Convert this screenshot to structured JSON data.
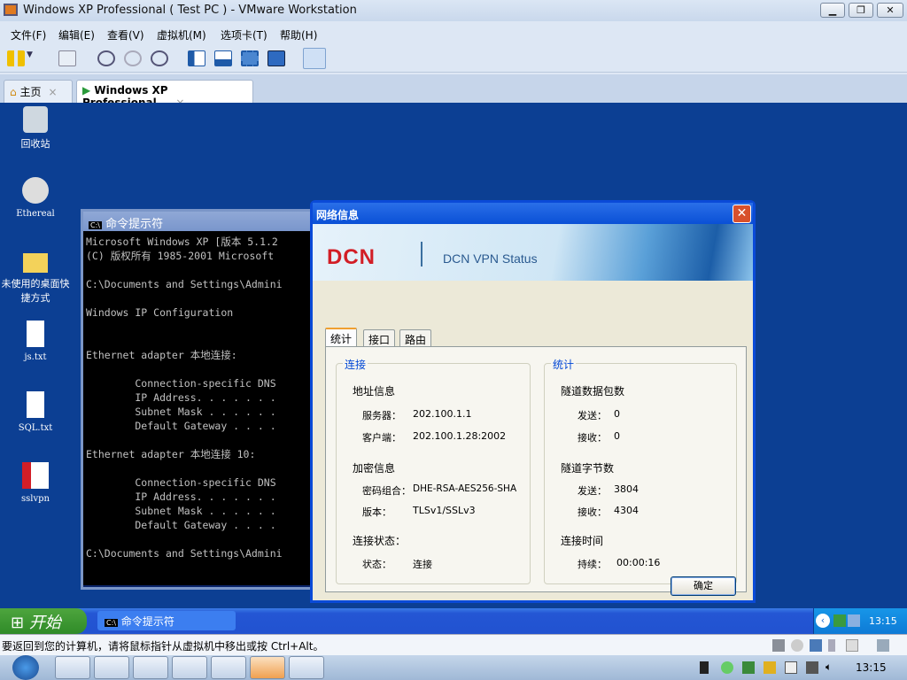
{
  "window": {
    "title": "Windows XP Professional ( Test PC ) - VMware Workstation",
    "min": "▁",
    "max": "❐",
    "close": "✕"
  },
  "menu": [
    "文件(F)",
    "编辑(E)",
    "查看(V)",
    "虚拟机(M)",
    "选项卡(T)",
    "帮助(H)"
  ],
  "tabs": [
    {
      "label": "主页",
      "close": "×"
    },
    {
      "label": "Windows XP Professional...",
      "close": "×"
    }
  ],
  "desktop_icons": [
    "回收站",
    "Ethereal",
    "未使用的桌面快捷方式",
    "js.txt",
    "SQL.txt",
    "sslvpn"
  ],
  "cmd": {
    "title": "命令提示符",
    "lines": [
      "Microsoft Windows XP [版本 5.1.2",
      "(C) 版权所有 1985-2001 Microsoft",
      "",
      "C:\\Documents and Settings\\Admini",
      "",
      "Windows IP Configuration",
      "",
      "",
      "Ethernet adapter 本地连接:",
      "",
      "        Connection-specific DNS",
      "        IP Address. . . . . . .",
      "        Subnet Mask . . . . . .",
      "        Default Gateway . . . .",
      "",
      "Ethernet adapter 本地连接 10:",
      "",
      "        Connection-specific DNS",
      "        IP Address. . . . . . .",
      "        Subnet Mask . . . . . .",
      "        Default Gateway . . . .",
      "",
      "C:\\Documents and Settings\\Admini"
    ]
  },
  "dialog": {
    "title": "网络信息",
    "close": "✕",
    "logo": "DCN",
    "banner_title": "DCN VPN Status",
    "tabs": [
      "统计",
      "接口",
      "路由"
    ],
    "left_group": {
      "title": "连接",
      "addr_header": "地址信息",
      "server_label": "服务器：",
      "server": "202.100.1.1",
      "client_label": "客户端：",
      "client": "202.100.1.28:2002",
      "enc_header": "加密信息",
      "cipher_label": "密码组合：",
      "cipher": "DHE-RSA-AES256-SHA",
      "version_label": "版本：",
      "version": "TLSv1/SSLv3",
      "state_header": "连接状态：",
      "state_label": "状态：",
      "state": "连接"
    },
    "right_group": {
      "title": "统计",
      "packets_header": "隧道数据包数",
      "pk_sent_label": "发送：",
      "pk_sent": "0",
      "pk_recv_label": "接收：",
      "pk_recv": "0",
      "bytes_header": "隧道字节数",
      "by_sent_label": "发送：",
      "by_sent": "3804",
      "by_recv_label": "接收：",
      "by_recv": "4304",
      "time_header": "连接时间",
      "dur_label": "持续：",
      "duration": "00:00:16"
    },
    "ok": "确定"
  },
  "xp_taskbar": {
    "start": "开始",
    "task": "命令提示符",
    "clock": "13:15"
  },
  "status_text": "要返回到您的计算机，请将鼠标指针从虚拟机中移出或按 Ctrl+Alt。",
  "win7_clock": "13:15"
}
